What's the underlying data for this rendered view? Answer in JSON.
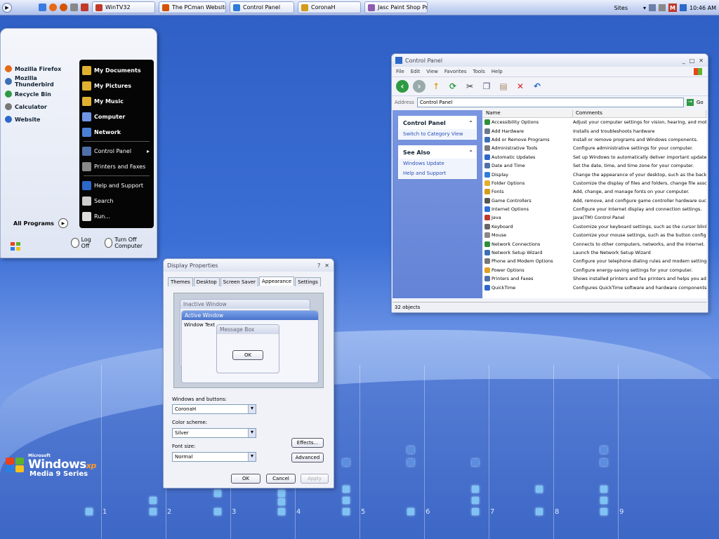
{
  "taskbar": {
    "tasks": [
      {
        "label": "WinTV32",
        "color": "#c0392b"
      },
      {
        "label": "The PCman Website - ...",
        "color": "#d35400"
      },
      {
        "label": "Control Panel",
        "color": "#2e7bd6"
      },
      {
        "label": "CoronaH",
        "color": "#d49a1a"
      },
      {
        "label": "Jasc Paint Shop Pro",
        "color": "#8e5bb0"
      }
    ],
    "sites_label": "Sites",
    "clock": "10:46 AM"
  },
  "start_menu": {
    "left_items": [
      {
        "label": "Mozilla Firefox",
        "color": "#e56a16"
      },
      {
        "label": "Mozilla Thunderbird",
        "color": "#3a6fb5"
      },
      {
        "label": "Recycle Bin",
        "color": "#2f9a43"
      },
      {
        "label": "Calculator",
        "color": "#777777"
      },
      {
        "label": "Website",
        "color": "#2b68c9"
      }
    ],
    "all_programs": "All Programs",
    "right_items": [
      {
        "label": "My Documents",
        "bold": true
      },
      {
        "label": "My Pictures",
        "bold": true
      },
      {
        "label": "My Music",
        "bold": true
      },
      {
        "label": "Computer",
        "bold": true
      },
      {
        "label": "Network",
        "bold": true
      },
      {
        "label": "Control Panel",
        "bold": false
      },
      {
        "label": "Printers and Faxes",
        "bold": false
      },
      {
        "label": "Help and Support",
        "bold": false
      },
      {
        "label": "Search",
        "bold": false
      },
      {
        "label": "Run...",
        "bold": false
      }
    ],
    "log_off": "Log Off",
    "turn_off": "Turn Off Computer"
  },
  "control_panel": {
    "title": "Control Panel",
    "menu": [
      "File",
      "Edit",
      "View",
      "Favorites",
      "Tools",
      "Help"
    ],
    "address_label": "Address",
    "address_value": "Control Panel",
    "go_label": "Go",
    "side_panel_title": "Control Panel",
    "switch_view": "Switch to Category View",
    "see_also_title": "See Also",
    "see_also_links": [
      "Windows Update",
      "Help and Support"
    ],
    "col_name": "Name",
    "col_comments": "Comments",
    "items": [
      {
        "name": "Accessibility Options",
        "comment": "Adjust your computer settings for vision, hearing, and mobility",
        "color": "#2f8f3a"
      },
      {
        "name": "Add Hardware",
        "comment": "Installs and troubleshoots hardware",
        "color": "#6b7a8c"
      },
      {
        "name": "Add or Remove Programs",
        "comment": "Install or remove programs and Windows components.",
        "color": "#3a6fb5"
      },
      {
        "name": "Administrative Tools",
        "comment": "Configure administrative settings for your computer.",
        "color": "#7a7a7a"
      },
      {
        "name": "Automatic Updates",
        "comment": "Set up Windows to automatically deliver important updates",
        "color": "#2b68c9"
      },
      {
        "name": "Date and Time",
        "comment": "Set the date, time, and time zone for your computer.",
        "color": "#4f6fa8"
      },
      {
        "name": "Display",
        "comment": "Change the appearance of your desktop, such as the backgro",
        "color": "#2f7bd6"
      },
      {
        "name": "Folder Options",
        "comment": "Customize the display of files and folders, change file associat",
        "color": "#e0b030"
      },
      {
        "name": "Fonts",
        "comment": "Add, change, and manage fonts on your computer.",
        "color": "#d49a1a"
      },
      {
        "name": "Game Controllers",
        "comment": "Add, remove, and configure game controller hardware such as",
        "color": "#555555"
      },
      {
        "name": "Internet Options",
        "comment": "Configure your Internet display and connection settings.",
        "color": "#2b6fd6"
      },
      {
        "name": "Java",
        "comment": "Java(TM) Control Panel",
        "color": "#c0392b"
      },
      {
        "name": "Keyboard",
        "comment": "Customize your keyboard settings, such as the cursor blink rat",
        "color": "#666666"
      },
      {
        "name": "Mouse",
        "comment": "Customize your mouse settings, such as the button configurat",
        "color": "#888888"
      },
      {
        "name": "Network Connections",
        "comment": "Connects to other computers, networks, and the Internet.",
        "color": "#2f8f3a"
      },
      {
        "name": "Network Setup Wizard",
        "comment": "Launch the Network Setup Wizard",
        "color": "#3a6fb5"
      },
      {
        "name": "Phone and Modem Options",
        "comment": "Configure your telephone dialing rules and modem settings.",
        "color": "#777777"
      },
      {
        "name": "Power Options",
        "comment": "Configure energy-saving settings for your computer.",
        "color": "#e0a020"
      },
      {
        "name": "Printers and Faxes",
        "comment": "Shows installed printers and fax printers and helps you add ne",
        "color": "#4f6fa8"
      },
      {
        "name": "QuickTime",
        "comment": "Configures QuickTime software and hardware components.",
        "color": "#2b68c9"
      }
    ],
    "status": "32 objects"
  },
  "display_props": {
    "title": "Display Properties",
    "tabs": [
      "Themes",
      "Desktop",
      "Screen Saver",
      "Appearance",
      "Settings"
    ],
    "active_tab": "Appearance",
    "preview": {
      "inactive": "Inactive Window",
      "active": "Active Window",
      "window_text": "Window Text",
      "message_box": "Message Box",
      "ok": "OK"
    },
    "windows_buttons_label": "Windows and buttons:",
    "windows_buttons_value": "CoronaH",
    "color_scheme_label": "Color scheme:",
    "color_scheme_value": "Silver",
    "font_size_label": "Font size:",
    "font_size_value": "Normal",
    "effects": "Effects...",
    "advanced": "Advanced",
    "ok": "OK",
    "cancel": "Cancel",
    "apply": "Apply"
  },
  "desktop": {
    "logo_small": "Microsoft",
    "logo_main": "Windows",
    "logo_xp": "xp",
    "logo_sub": "Media 9 Series",
    "numbers": [
      "1",
      "2",
      "3",
      "4",
      "5",
      "6",
      "7",
      "8",
      "9"
    ]
  }
}
